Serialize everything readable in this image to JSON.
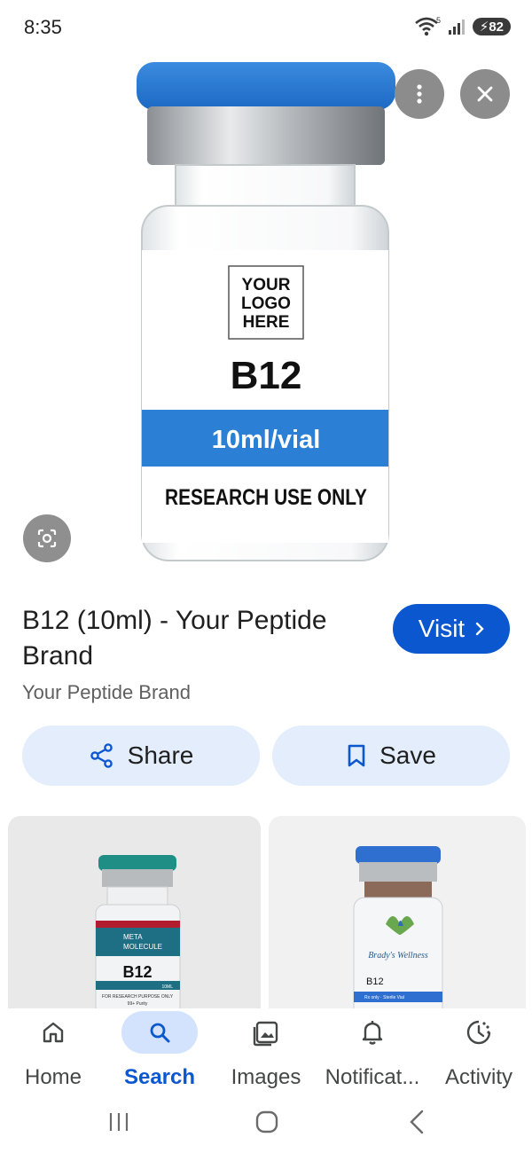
{
  "status": {
    "time": "8:35",
    "battery": "82",
    "wifi_badge": "5"
  },
  "hero": {
    "logo_lines": [
      "YOUR",
      "LOGO",
      "HERE"
    ],
    "product": "B12",
    "volume": "10ml/vial",
    "disclaimer": "RESEARCH USE ONLY"
  },
  "result": {
    "title": "B12 (10ml) - Your Peptide Brand",
    "source": "Your Peptide Brand",
    "visit_label": "Visit",
    "share_label": "Share",
    "save_label": "Save"
  },
  "thumbs": [
    {
      "brand_line1": "META",
      "brand_line2": "MOLECULE",
      "product": "B12",
      "small_print": "FOR RESEARCH PURPOSE ONLY",
      "purity": "99+ Purity",
      "volume": "10ML"
    },
    {
      "brand": "Brady's Wellness",
      "product": "B12",
      "small_print": "Rx only · Sterile Vial"
    }
  ],
  "nav": [
    {
      "label": "Home",
      "icon": "home-icon"
    },
    {
      "label": "Search",
      "icon": "search-icon",
      "active": true
    },
    {
      "label": "Images",
      "icon": "images-icon"
    },
    {
      "label": "Notificat...",
      "icon": "bell-icon"
    },
    {
      "label": "Activity",
      "icon": "activity-icon"
    }
  ],
  "colors": {
    "accent": "#0b57d0",
    "chip_bg": "#e3edfc",
    "vial_cap": "#2f7fd6",
    "vial_band": "#2b7fd4"
  }
}
